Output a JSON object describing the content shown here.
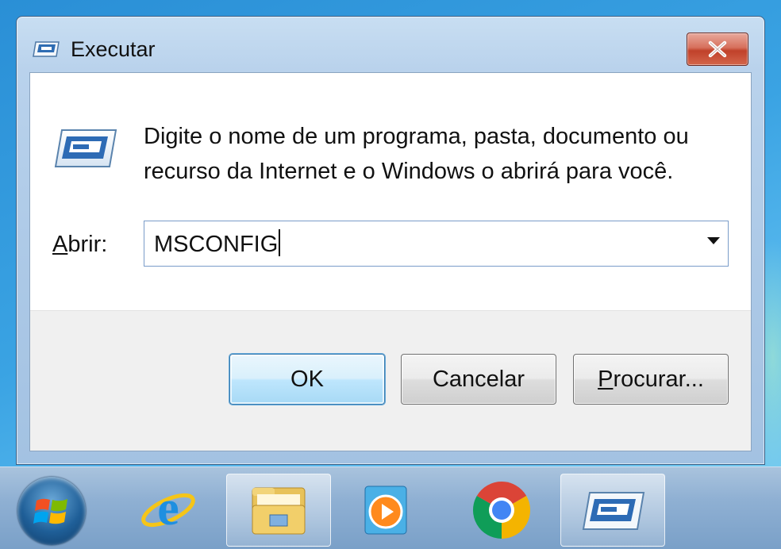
{
  "window": {
    "title": "Executar",
    "close_label": "×",
    "description_line1": "Digite o nome de um programa, pasta, documento ou",
    "description_line2": "recurso da Internet e o Windows o abrirá para você.",
    "open_label_accel": "A",
    "open_label_rest": "brir:",
    "open_value": "MSCONFIG",
    "buttons": {
      "ok": "OK",
      "cancel": "Cancelar",
      "browse_accel": "P",
      "browse_rest": "rocurar..."
    }
  },
  "taskbar": {
    "items": [
      {
        "icon": "windows-start-orb-icon"
      },
      {
        "icon": "internet-explorer-icon"
      },
      {
        "icon": "windows-explorer-folder-icon"
      },
      {
        "icon": "windows-media-player-icon"
      },
      {
        "icon": "google-chrome-icon"
      },
      {
        "icon": "run-dialog-icon",
        "active": true
      }
    ]
  },
  "colors": {
    "desktop": "#2a8fd6",
    "window_frame": "#abc8e6",
    "close_button": "#c0412a",
    "default_button": "#bee6fd"
  }
}
